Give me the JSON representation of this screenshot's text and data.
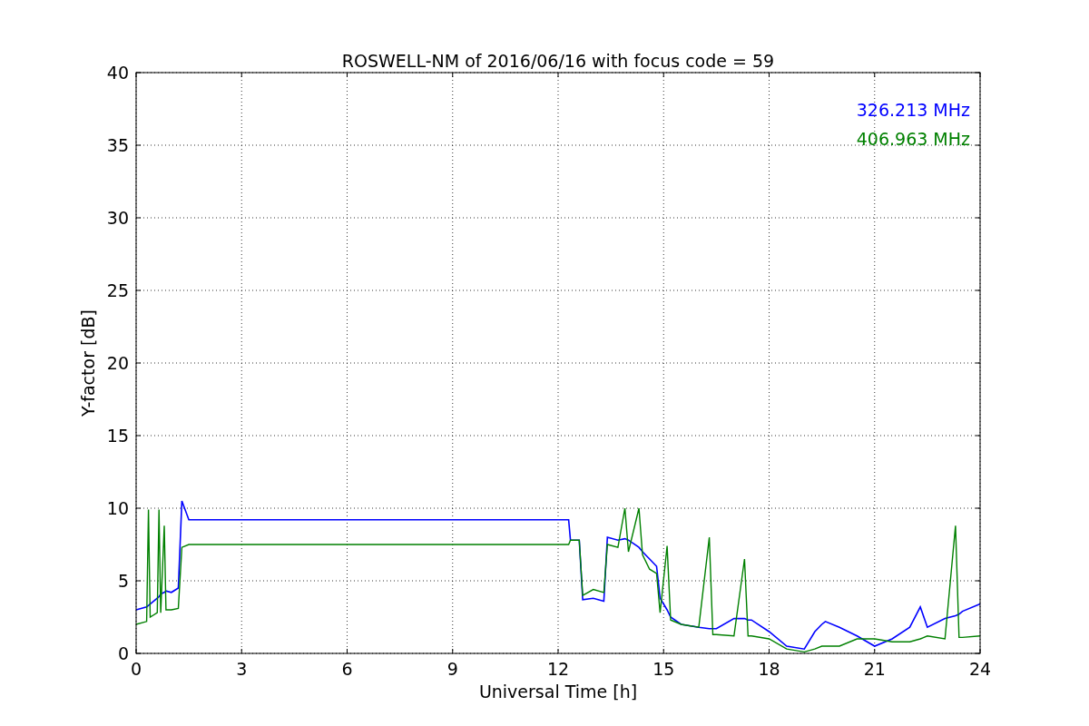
{
  "figure": {
    "chart_data": {
      "type": "line",
      "title": "ROSWELL-NM of 2016/06/16 with focus code = 59",
      "xlabel": "Universal Time [h]",
      "ylabel": "Y-factor [dB]",
      "x": [
        0,
        0.3,
        0.35,
        0.4,
        0.6,
        0.65,
        0.7,
        0.8,
        0.85,
        1.0,
        1.2,
        1.3,
        1.5,
        12.3,
        12.35,
        12.6,
        12.7,
        13,
        13.3,
        13.4,
        13.7,
        13.9,
        14,
        14.3,
        14.4,
        14.6,
        14.8,
        14.9,
        15.1,
        15.2,
        15.5,
        16,
        16.3,
        16.4,
        16.5,
        17,
        17.3,
        17.4,
        17.5,
        18,
        18.5,
        19,
        19.3,
        19.5,
        19.6,
        20,
        20.5,
        21,
        21.5,
        22,
        22.3,
        22.5,
        23,
        23.3,
        23.4,
        23.5,
        24
      ],
      "series": [
        {
          "name": "326.213 MHz",
          "color": "#0000ff",
          "values": [
            3.0,
            3.2,
            3.3,
            3.4,
            3.8,
            3.9,
            4.1,
            4.2,
            4.3,
            4.2,
            4.5,
            10.5,
            9.2,
            9.2,
            7.8,
            7.8,
            3.7,
            3.8,
            3.6,
            8.0,
            7.8,
            7.9,
            7.8,
            7.3,
            7.0,
            6.5,
            6.0,
            3.8,
            3.0,
            2.5,
            2.0,
            1.8,
            1.7,
            1.7,
            1.7,
            2.4,
            2.4,
            2.3,
            2.3,
            1.5,
            0.5,
            0.3,
            1.5,
            2.0,
            2.2,
            1.8,
            1.2,
            0.5,
            1.0,
            1.8,
            3.2,
            1.8,
            2.4,
            2.6,
            2.7,
            2.9,
            3.4
          ]
        },
        {
          "name": "406.963 MHz",
          "color": "#008000",
          "values": [
            2.0,
            2.2,
            9.9,
            2.5,
            2.8,
            9.9,
            2.8,
            8.8,
            3.0,
            3.0,
            3.1,
            7.3,
            7.5,
            7.5,
            7.8,
            7.8,
            4.0,
            4.4,
            4.2,
            7.5,
            7.3,
            10.0,
            7.0,
            10.0,
            6.8,
            5.8,
            5.5,
            2.8,
            7.4,
            2.3,
            2.0,
            1.8,
            8.0,
            1.3,
            1.3,
            1.2,
            6.5,
            1.2,
            1.2,
            1.0,
            0.3,
            0.1,
            0.3,
            0.5,
            0.5,
            0.5,
            1.0,
            1.0,
            0.8,
            0.8,
            1.0,
            1.2,
            1.0,
            8.8,
            1.1,
            1.1,
            1.2
          ]
        }
      ],
      "grid": true,
      "xlim": [
        0,
        24
      ],
      "ylim": [
        0,
        40
      ],
      "xticks": [
        0,
        3,
        6,
        9,
        12,
        15,
        18,
        21,
        24
      ],
      "yticks": [
        0,
        5,
        10,
        15,
        20,
        25,
        30,
        35,
        40
      ]
    }
  }
}
